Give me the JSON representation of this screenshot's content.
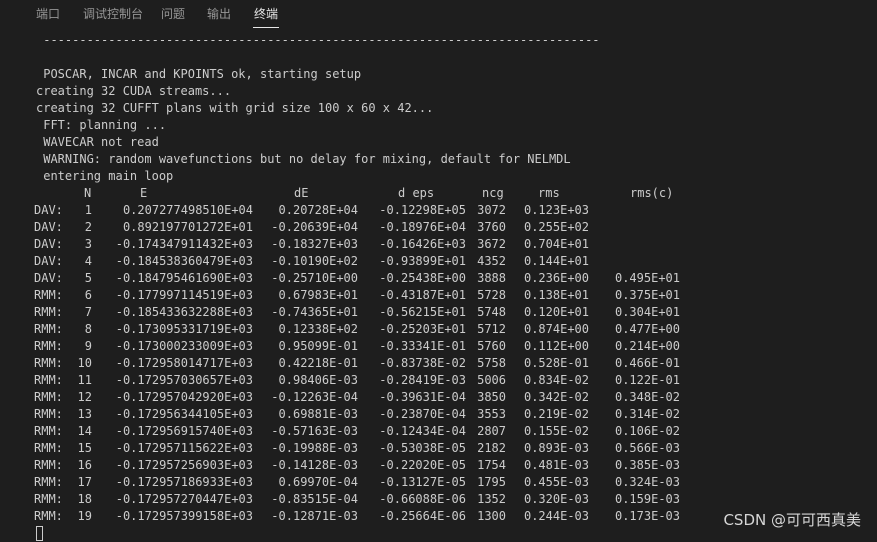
{
  "tabs": [
    "端口",
    "调试控制台",
    "问题",
    "输出",
    "终端"
  ],
  "active_tab": "终端",
  "terminal": {
    "separator": " -----------------------------------------------------------------------------",
    "pre_lines": [
      "",
      " POSCAR, INCAR and KPOINTS ok, starting setup",
      "creating 32 CUDA streams...",
      "creating 32 CUFFT plans with grid size 100 x 60 x 42...",
      " FFT: planning ...",
      " WAVECAR not read",
      " WARNING: random wavefunctions but no delay for mixing, default for NELMDL",
      " entering main loop"
    ],
    "header": [
      "N",
      "E",
      "dE",
      "d eps",
      "ncg",
      "rms",
      "rms(c)"
    ],
    "rows": [
      [
        "DAV:",
        "1",
        "0.207277498510E+04",
        "0.20728E+04",
        "-0.12298E+05",
        "3072",
        "0.123E+03",
        ""
      ],
      [
        "DAV:",
        "2",
        "0.892197701272E+01",
        "-0.20639E+04",
        "-0.18976E+04",
        "3760",
        "0.255E+02",
        ""
      ],
      [
        "DAV:",
        "3",
        "-0.174347911432E+03",
        "-0.18327E+03",
        "-0.16426E+03",
        "3672",
        "0.704E+01",
        ""
      ],
      [
        "DAV:",
        "4",
        "-0.184538360479E+03",
        "-0.10190E+02",
        "-0.93899E+01",
        "4352",
        "0.144E+01",
        ""
      ],
      [
        "DAV:",
        "5",
        "-0.184795461690E+03",
        "-0.25710E+00",
        "-0.25438E+00",
        "3888",
        "0.236E+00",
        "0.495E+01"
      ],
      [
        "RMM:",
        "6",
        "-0.177997114519E+03",
        "0.67983E+01",
        "-0.43187E+01",
        "5728",
        "0.138E+01",
        "0.375E+01"
      ],
      [
        "RMM:",
        "7",
        "-0.185433632288E+03",
        "-0.74365E+01",
        "-0.56215E+01",
        "5748",
        "0.120E+01",
        "0.304E+01"
      ],
      [
        "RMM:",
        "8",
        "-0.173095331719E+03",
        "0.12338E+02",
        "-0.25203E+01",
        "5712",
        "0.874E+00",
        "0.477E+00"
      ],
      [
        "RMM:",
        "9",
        "-0.173000233009E+03",
        "0.95099E-01",
        "-0.33341E-01",
        "5760",
        "0.112E+00",
        "0.214E+00"
      ],
      [
        "RMM:",
        "10",
        "-0.172958014717E+03",
        "0.42218E-01",
        "-0.83738E-02",
        "5758",
        "0.528E-01",
        "0.466E-01"
      ],
      [
        "RMM:",
        "11",
        "-0.172957030657E+03",
        "0.98406E-03",
        "-0.28419E-03",
        "5006",
        "0.834E-02",
        "0.122E-01"
      ],
      [
        "RMM:",
        "12",
        "-0.172957042920E+03",
        "-0.12263E-04",
        "-0.39631E-04",
        "3850",
        "0.342E-02",
        "0.348E-02"
      ],
      [
        "RMM:",
        "13",
        "-0.172956344105E+03",
        "0.69881E-03",
        "-0.23870E-04",
        "3553",
        "0.219E-02",
        "0.314E-02"
      ],
      [
        "RMM:",
        "14",
        "-0.172956915740E+03",
        "-0.57163E-03",
        "-0.12434E-04",
        "2807",
        "0.155E-02",
        "0.106E-02"
      ],
      [
        "RMM:",
        "15",
        "-0.172957115622E+03",
        "-0.19988E-03",
        "-0.53038E-05",
        "2182",
        "0.893E-03",
        "0.566E-03"
      ],
      [
        "RMM:",
        "16",
        "-0.172957256903E+03",
        "-0.14128E-03",
        "-0.22020E-05",
        "1754",
        "0.481E-03",
        "0.385E-03"
      ],
      [
        "RMM:",
        "17",
        "-0.172957186933E+03",
        "0.69970E-04",
        "-0.13127E-05",
        "1795",
        "0.455E-03",
        "0.324E-03"
      ],
      [
        "RMM:",
        "18",
        "-0.172957270447E+03",
        "-0.83515E-04",
        "-0.66088E-06",
        "1352",
        "0.320E-03",
        "0.159E-03"
      ],
      [
        "RMM:",
        "19",
        "-0.172957399158E+03",
        "-0.12871E-03",
        "-0.25664E-06",
        "1300",
        "0.244E-03",
        "0.173E-03"
      ]
    ]
  },
  "watermark": "CSDN @可可西真美"
}
